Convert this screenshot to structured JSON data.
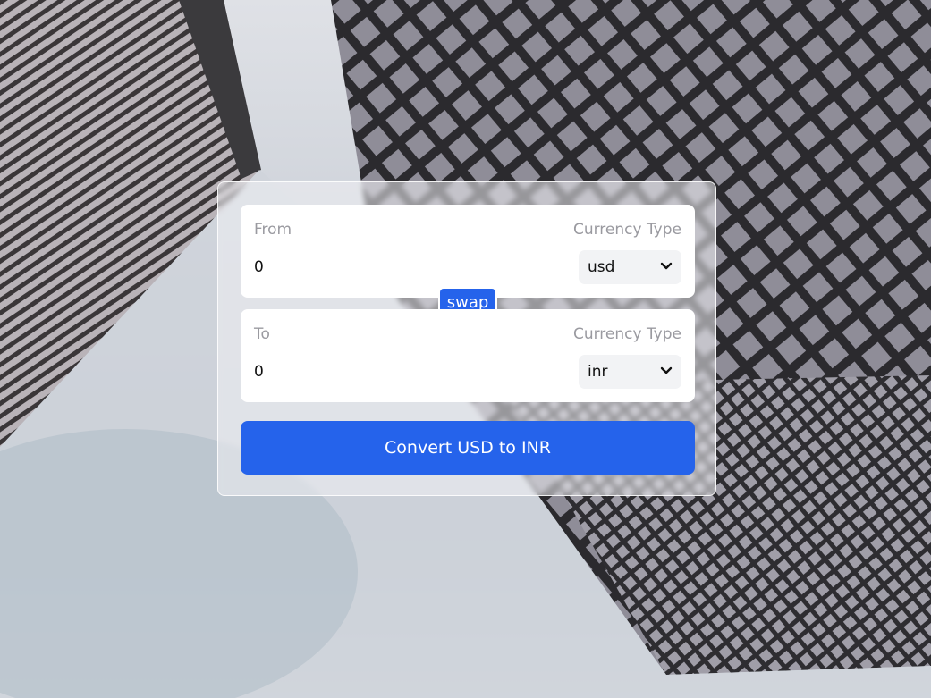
{
  "from": {
    "label": "From",
    "currency_label": "Currency Type",
    "amount": "0",
    "currency": "usd"
  },
  "to": {
    "label": "To",
    "currency_label": "Currency Type",
    "amount": "0",
    "currency": "inr"
  },
  "swap_label": "swap",
  "convert_label": "Convert USD to INR",
  "colors": {
    "accent": "#2563eb",
    "panel": "#ffffff",
    "label": "#9a9aa0"
  },
  "icons": {
    "select_arrow": "chevron-down-icon"
  }
}
